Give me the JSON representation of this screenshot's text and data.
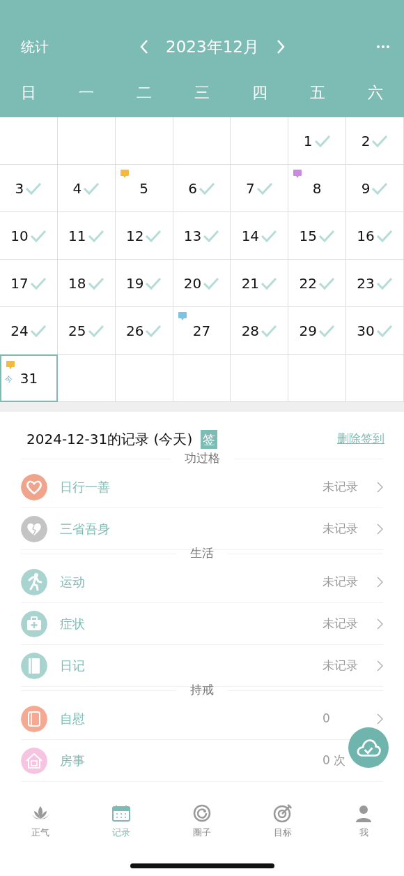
{
  "header": {
    "left": "统计",
    "month": "2023年12月"
  },
  "weekdays": [
    "日",
    "一",
    "二",
    "三",
    "四",
    "五",
    "六"
  ],
  "weeks": [
    [
      {
        "kind": "blank"
      },
      {
        "kind": "blank"
      },
      {
        "kind": "blank"
      },
      {
        "kind": "blank"
      },
      {
        "kind": "blank"
      },
      {
        "kind": "day",
        "day": "1",
        "checked": true
      },
      {
        "kind": "day",
        "day": "2",
        "checked": true
      }
    ],
    [
      {
        "kind": "day",
        "day": "3",
        "checked": true
      },
      {
        "kind": "day",
        "day": "4",
        "checked": true
      },
      {
        "kind": "day",
        "day": "5",
        "checked": false,
        "color": "#f5b942"
      },
      {
        "kind": "day",
        "day": "6",
        "checked": true
      },
      {
        "kind": "day",
        "day": "7",
        "checked": true
      },
      {
        "kind": "day",
        "day": "8",
        "checked": false,
        "color": "#c98be0"
      },
      {
        "kind": "day",
        "day": "9",
        "checked": true
      }
    ],
    [
      {
        "kind": "day",
        "day": "10",
        "checked": true
      },
      {
        "kind": "day",
        "day": "11",
        "checked": true
      },
      {
        "kind": "day",
        "day": "12",
        "checked": true
      },
      {
        "kind": "day",
        "day": "13",
        "checked": true
      },
      {
        "kind": "day",
        "day": "14",
        "checked": true
      },
      {
        "kind": "day",
        "day": "15",
        "checked": true
      },
      {
        "kind": "day",
        "day": "16",
        "checked": true
      }
    ],
    [
      {
        "kind": "day",
        "day": "17",
        "checked": true
      },
      {
        "kind": "day",
        "day": "18",
        "checked": true
      },
      {
        "kind": "day",
        "day": "19",
        "checked": true
      },
      {
        "kind": "day",
        "day": "20",
        "checked": true
      },
      {
        "kind": "day",
        "day": "21",
        "checked": true
      },
      {
        "kind": "day",
        "day": "22",
        "checked": true
      },
      {
        "kind": "day",
        "day": "23",
        "checked": true
      }
    ],
    [
      {
        "kind": "day",
        "day": "24",
        "checked": true
      },
      {
        "kind": "day",
        "day": "25",
        "checked": true
      },
      {
        "kind": "day",
        "day": "26",
        "checked": true
      },
      {
        "kind": "day",
        "day": "27",
        "checked": false,
        "color": "#7cc3e8"
      },
      {
        "kind": "day",
        "day": "28",
        "checked": true
      },
      {
        "kind": "day",
        "day": "29",
        "checked": true
      },
      {
        "kind": "day",
        "day": "30",
        "checked": true
      }
    ],
    [
      {
        "kind": "day",
        "day": "31",
        "checked": false,
        "color": "#f5b942",
        "selected": true,
        "today_label": "今"
      },
      {
        "kind": "blank"
      },
      {
        "kind": "blank"
      },
      {
        "kind": "blank"
      },
      {
        "kind": "blank"
      },
      {
        "kind": "blank"
      },
      {
        "kind": "blank"
      }
    ]
  ],
  "record": {
    "title": "2024-12-31的记录 (今天)",
    "badge": "签",
    "action": "删除签到"
  },
  "sections": [
    {
      "title": "功过格",
      "items": [
        {
          "color": "#f0a48c",
          "label": "日行一善",
          "value": "未记录"
        },
        {
          "color": "#c4c4c4",
          "label": "三省吾身",
          "value": "未记录"
        }
      ]
    },
    {
      "title": "生活",
      "items": [
        {
          "color": "#a8d3ce",
          "label": "运动",
          "value": "未记录"
        },
        {
          "color": "#a8d3ce",
          "label": "症状",
          "value": "未记录"
        },
        {
          "color": "#a8d3ce",
          "label": "日记",
          "value": "未记录"
        }
      ]
    },
    {
      "title": "持戒",
      "items": [
        {
          "color": "#f5a892",
          "label": "自慰",
          "value": "0"
        },
        {
          "color": "#f6c4e0",
          "label": "房事",
          "value": "0 次"
        }
      ]
    }
  ],
  "tabs": [
    {
      "label": "正气",
      "selected": false
    },
    {
      "label": "记录",
      "selected": true
    },
    {
      "label": "圈子",
      "selected": false
    },
    {
      "label": "目标",
      "selected": false
    },
    {
      "label": "我",
      "selected": false
    }
  ]
}
